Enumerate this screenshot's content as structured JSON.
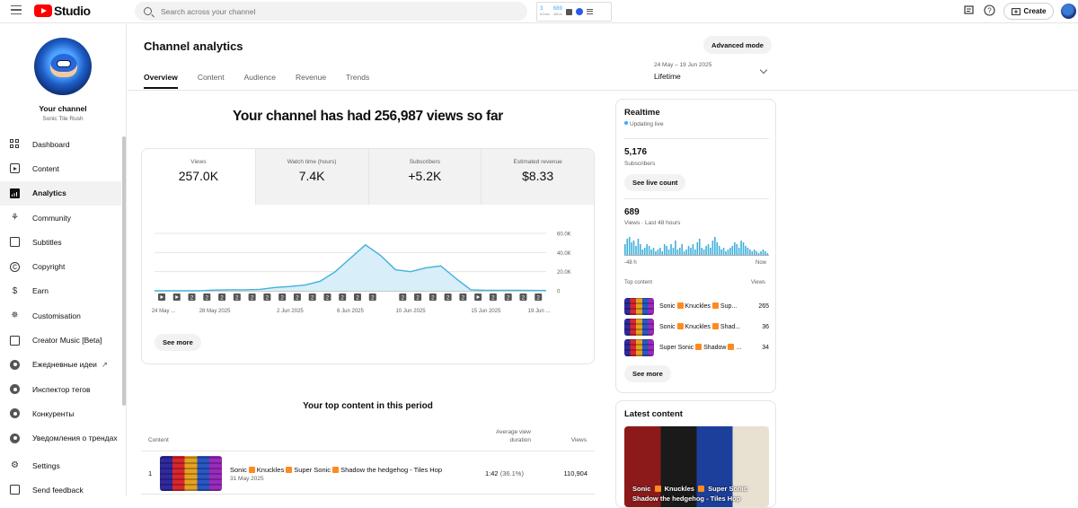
{
  "topbar": {
    "logo_text": "Studio",
    "search_placeholder": "Search across your channel",
    "ext_count_a": "3",
    "ext_count_a_sub": "60min",
    "ext_count_b": "689",
    "ext_count_b_sub": "48hrs",
    "create_label": "Create"
  },
  "sidebar": {
    "channel_title": "Your channel",
    "channel_handle": "Sonic Tile Rush",
    "items": [
      {
        "label": "Dashboard",
        "icon": "dashboard-icon"
      },
      {
        "label": "Content",
        "icon": "content-icon"
      },
      {
        "label": "Analytics",
        "icon": "analytics-icon",
        "active": true
      },
      {
        "label": "Community",
        "icon": "community-icon"
      },
      {
        "label": "Subtitles",
        "icon": "subtitles-icon"
      },
      {
        "label": "Copyright",
        "icon": "copyright-icon"
      },
      {
        "label": "Earn",
        "icon": "dollar-icon"
      },
      {
        "label": "Customisation",
        "icon": "wand-icon"
      },
      {
        "label": "Creator Music [Beta]",
        "icon": "music-icon"
      },
      {
        "label": "Ежедневные идеи",
        "icon": "extension-icon"
      },
      {
        "label": "Инспектор тегов",
        "icon": "extension-icon"
      },
      {
        "label": "Конкуренты",
        "icon": "extension-icon"
      },
      {
        "label": "Уведомления о трендах",
        "icon": "extension-icon"
      },
      {
        "label": "Settings",
        "icon": "gear-icon"
      },
      {
        "label": "Send feedback",
        "icon": "feedback-icon"
      }
    ]
  },
  "header": {
    "title": "Channel analytics",
    "advanced_mode": "Advanced mode",
    "tabs": [
      "Overview",
      "Content",
      "Audience",
      "Revenue",
      "Trends"
    ],
    "active_tab": "Overview",
    "date_range": "24 May – 19 Jun 2025",
    "period": "Lifetime"
  },
  "overview": {
    "headline": "Your channel has had 256,987 views so far",
    "metrics": [
      {
        "label": "Views",
        "value": "257.0K"
      },
      {
        "label": "Watch time (hours)",
        "value": "7.4K"
      },
      {
        "label": "Subscribers",
        "value": "+5.2K"
      },
      {
        "label": "Estimated revenue",
        "value": "$8.33"
      }
    ],
    "see_more": "See more"
  },
  "chart_data": {
    "type": "area",
    "x_tick_labels": [
      "24 May ...",
      "28 May 2025",
      "2 Jun 2025",
      "6 Jun 2025",
      "10 Jun 2025",
      "15 Jun 2025",
      "19 Jun ..."
    ],
    "y_tick_labels": [
      "60.0K",
      "40.0K",
      "20.0K",
      "0"
    ],
    "ylim": [
      0,
      60000
    ],
    "x": [
      "24 May",
      "25 May",
      "26 May",
      "27 May",
      "28 May",
      "29 May",
      "30 May",
      "31 May",
      "1 Jun",
      "2 Jun",
      "3 Jun",
      "4 Jun",
      "5 Jun",
      "6 Jun",
      "7 Jun",
      "8 Jun",
      "9 Jun",
      "10 Jun",
      "11 Jun",
      "12 Jun",
      "13 Jun",
      "14 Jun",
      "15 Jun",
      "16 Jun",
      "17 Jun",
      "18 Jun",
      "19 Jun"
    ],
    "values": [
      0,
      0,
      0,
      0,
      800,
      1000,
      1000,
      1500,
      3500,
      4500,
      6000,
      10000,
      20000,
      34000,
      48000,
      37000,
      22000,
      20000,
      24000,
      26000,
      13000,
      1000,
      500,
      500,
      500,
      400,
      300
    ],
    "series_color": "#41b0dc",
    "grid": true,
    "video_markers": [
      "play",
      "play",
      "2",
      "2",
      "2",
      "2",
      "2",
      "2",
      "2",
      "2",
      "2",
      "2",
      "2",
      "2",
      "2",
      "",
      "2",
      "2",
      "2",
      "2",
      "2",
      "play",
      "2",
      "2",
      "2",
      "2"
    ]
  },
  "top_content": {
    "title": "Your top content in this period",
    "col_content": "Content",
    "col_avd": "Average view duration",
    "col_views": "Views",
    "rows": [
      {
        "rank": "1",
        "title_parts": [
          "Sonic",
          "Knuckles",
          "Super Sonic",
          "Shadow the hedgehog - Tiles Hop"
        ],
        "date": "31 May 2025",
        "avd": "1:42",
        "avd_pct": "(36.1%)",
        "views": "110,904"
      }
    ]
  },
  "realtime": {
    "title": "Realtime",
    "live_label": "Updating live",
    "subs_value": "5,176",
    "subs_label": "Subscribers",
    "see_live": "See live count",
    "views_value": "689",
    "views_label": "Views · Last 48 hours",
    "axis_left": "-48 h",
    "axis_right": "Now",
    "bars": [
      6,
      9,
      10,
      7,
      8,
      5,
      9,
      6,
      3,
      4,
      6,
      5,
      3,
      4,
      2,
      3,
      4,
      2,
      6,
      5,
      3,
      6,
      4,
      8,
      3,
      4,
      6,
      2,
      3,
      5,
      4,
      6,
      3,
      7,
      9,
      4,
      3,
      5,
      6,
      4,
      8,
      10,
      7,
      5,
      3,
      4,
      2,
      3,
      4,
      5,
      7,
      6,
      4,
      8,
      7,
      5,
      4,
      3,
      2,
      3,
      2,
      1,
      2,
      3,
      2,
      1
    ],
    "top_content_label": "Top content",
    "top_views_label": "Views",
    "top_rows": [
      {
        "parts": [
          "Sonic",
          "Knuckles",
          "Sup..."
        ],
        "views": "265"
      },
      {
        "parts": [
          "Sonic",
          "Knuckles",
          "Shad..."
        ],
        "views": "36"
      },
      {
        "parts": [
          "Super Sonic",
          "Shadow",
          "..."
        ],
        "views": "34"
      }
    ],
    "see_more": "See more"
  },
  "latest": {
    "title": "Latest content",
    "thumb_caption_a": "Sonic",
    "thumb_caption_b": "Knuckles",
    "thumb_caption_c": "Super Sonic",
    "thumb_caption_d": "Shadow the hedgehog - Tiles Hop"
  }
}
